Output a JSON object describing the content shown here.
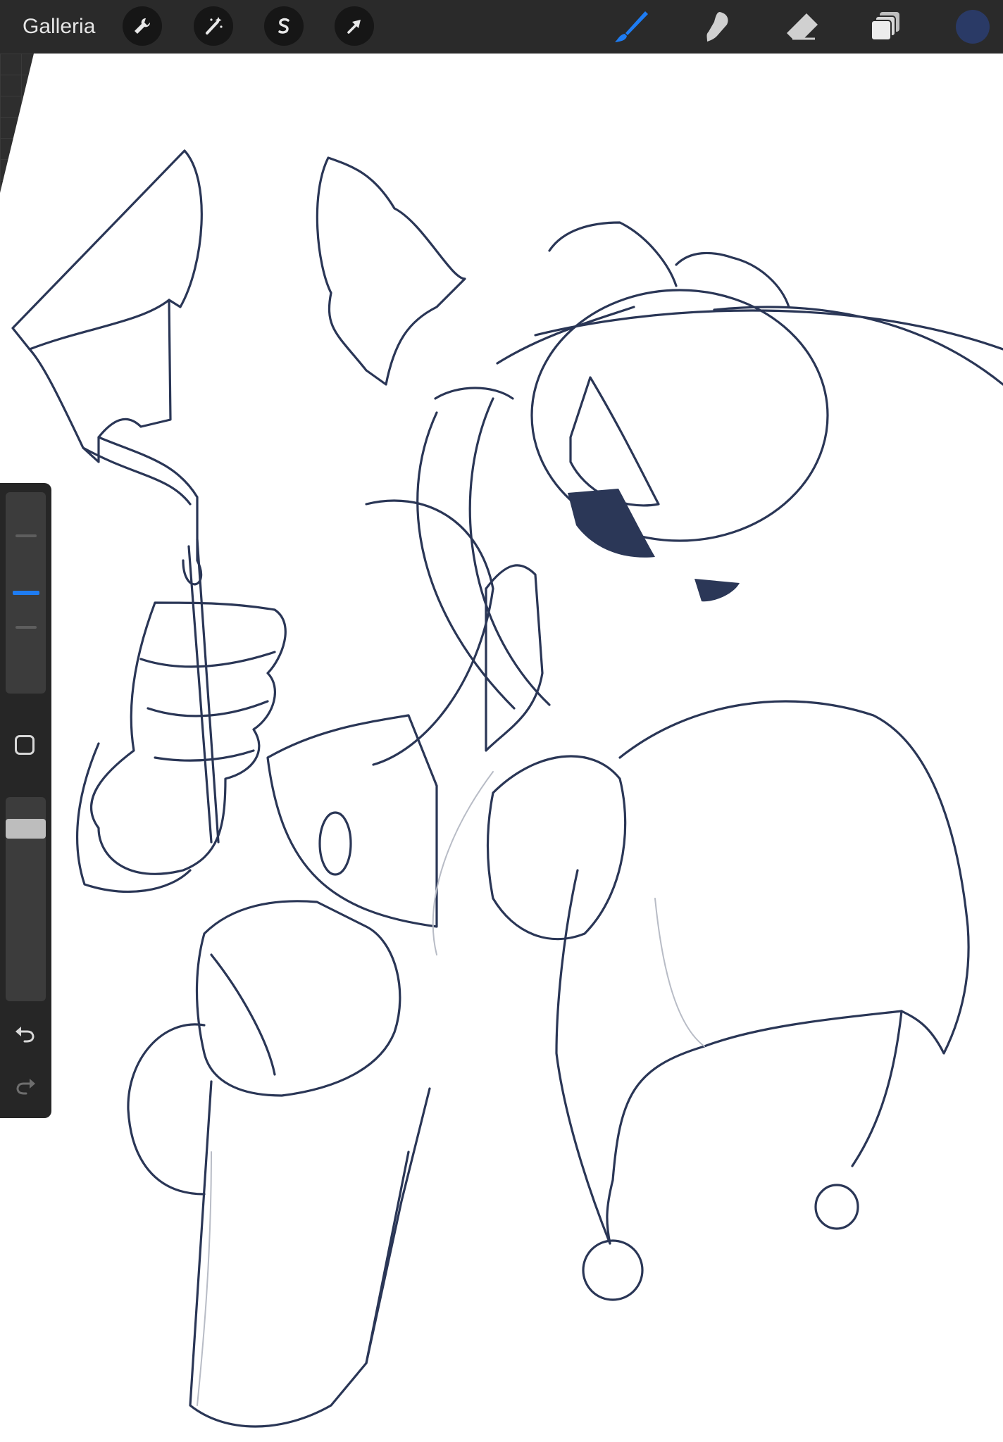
{
  "toolbar": {
    "gallery_label": "Galleria",
    "actions": [
      {
        "name": "actions-button",
        "icon": "wrench-icon"
      },
      {
        "name": "adjustments-button",
        "icon": "magic-wand-icon"
      },
      {
        "name": "selection-button",
        "icon": "selection-s-icon"
      },
      {
        "name": "transform-button",
        "icon": "arrow-cursor-icon"
      }
    ],
    "tools": [
      {
        "name": "brush-tool",
        "icon": "brush-icon",
        "active": true
      },
      {
        "name": "smudge-tool",
        "icon": "smudge-finger-icon",
        "active": false
      },
      {
        "name": "eraser-tool",
        "icon": "eraser-icon",
        "active": false
      },
      {
        "name": "layers-button",
        "icon": "layers-icon",
        "active": false
      }
    ],
    "current_color": "#2a3a66",
    "active_tool_color": "#1e7cf2"
  },
  "sidebar": {
    "brush_size_level": 0.5,
    "opacity_level": 0.88,
    "modify_button_icon": "square-icon",
    "undo_icon": "undo-icon",
    "redo_icon": "redo-icon"
  },
  "canvas": {
    "background": "#ffffff",
    "ink_color": "#2a3656",
    "fill_color": "#2b3757"
  }
}
